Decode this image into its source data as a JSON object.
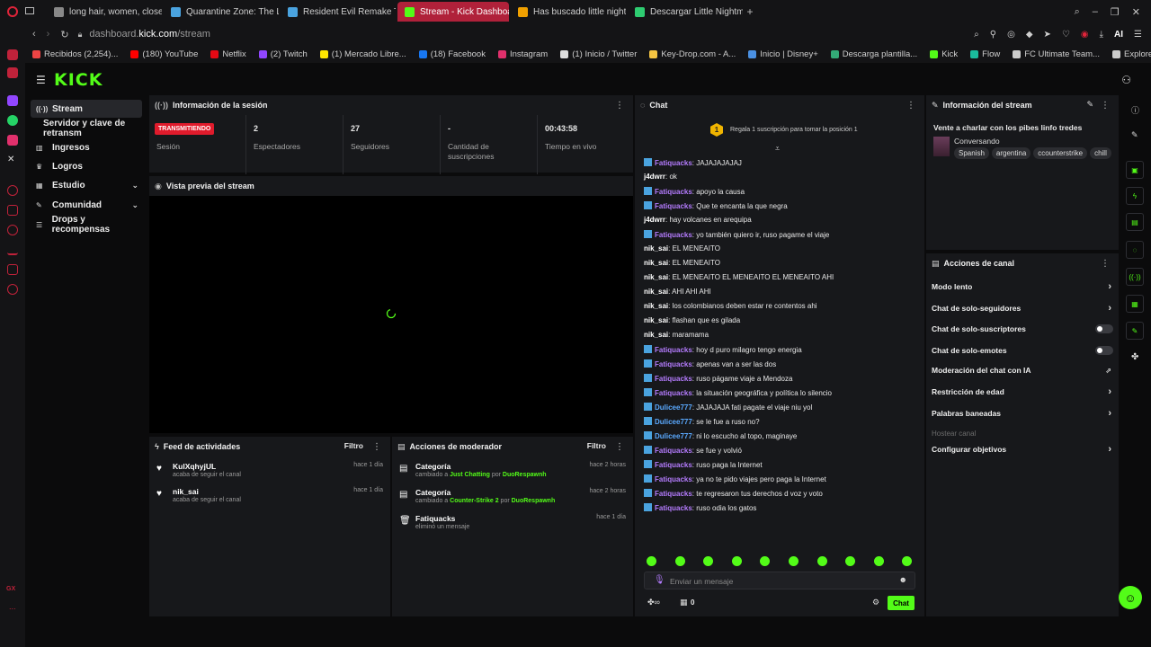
{
  "browser": {
    "tabs": [
      {
        "label": "long hair, women, closed",
        "color": "#888"
      },
      {
        "label": "Quarantine Zone: The Las",
        "color": "#4aa3df"
      },
      {
        "label": "Resident Evil Remake Trilo",
        "color": "#4aa3df"
      },
      {
        "label": "Stream - Kick Dashboard",
        "color": "#53fc18",
        "active": true
      },
      {
        "label": "Has buscado little nightma",
        "color": "#f0a000"
      },
      {
        "label": "Descargar Little Nightmare",
        "color": "#2ecc71"
      }
    ],
    "new_tab": "+",
    "url_domain": "dashboard.",
    "url_host": "kick.com",
    "url_path": "/stream",
    "ai_label": "AI",
    "bookmarks": [
      {
        "label": "Recibidos (2,254)...",
        "color": "#e44"
      },
      {
        "label": "(180) YouTube",
        "color": "#f00"
      },
      {
        "label": "Netflix",
        "color": "#e50914"
      },
      {
        "label": "(2) Twitch",
        "color": "#9146ff"
      },
      {
        "label": "(1) Mercado Libre...",
        "color": "#ffe600"
      },
      {
        "label": "(18) Facebook",
        "color": "#1877f2"
      },
      {
        "label": "Instagram",
        "color": "#e1306c"
      },
      {
        "label": "(1) Inicio / Twitter",
        "color": "#ddd"
      },
      {
        "label": "Key-Drop.com - A...",
        "color": "#f5c542"
      },
      {
        "label": "Inicio | Disney+",
        "color": "#4a90e2"
      },
      {
        "label": "Descarga plantilla...",
        "color": "#3a7"
      },
      {
        "label": "Kick",
        "color": "#53fc18"
      },
      {
        "label": "Flow",
        "color": "#1abc9c"
      },
      {
        "label": "FC Ultimate Team...",
        "color": "#ccc"
      },
      {
        "label": "Explore GPTs",
        "color": "#ccc"
      }
    ]
  },
  "opera_side": {
    "gx_label": "GX",
    "more": "..."
  },
  "kick": {
    "logo": "KICK",
    "nav": [
      {
        "label": "Stream"
      },
      {
        "label": "Servidor y clave de retransm"
      },
      {
        "label": "Ingresos"
      },
      {
        "label": "Logros"
      },
      {
        "label": "Estudio"
      },
      {
        "label": "Comunidad"
      },
      {
        "label": "Drops y recompensas"
      }
    ]
  },
  "session": {
    "title": "Información de la sesión",
    "live_badge": "TRANSMITIENDO",
    "stats": [
      {
        "value": "",
        "label": "Sesión"
      },
      {
        "value": "2",
        "label": "Espectadores"
      },
      {
        "value": "27",
        "label": "Seguidores"
      },
      {
        "value": "-",
        "label": "Cantidad de suscripciones"
      },
      {
        "value": "00:43:58",
        "label": "Tiempo en vivo"
      }
    ]
  },
  "preview": {
    "title": "Vista previa del stream"
  },
  "feed": {
    "title": "Feed de actividades",
    "filter": "Filtro",
    "items": [
      {
        "name": "KulXqhyjUL",
        "sub": "acaba de seguir el canal",
        "date": "hace 1 día"
      },
      {
        "name": "nik_sai",
        "sub": "acaba de seguir el canal",
        "date": "hace 1 día"
      }
    ]
  },
  "modactions": {
    "title": "Acciones de moderador",
    "filter": "Filtro",
    "items": [
      {
        "title": "Categoría",
        "pre": "cambiado a ",
        "cat": "Just Chatting",
        "por": " por ",
        "user": "DuoRespawnh",
        "date": "hace 2 horas"
      },
      {
        "title": "Categoría",
        "pre": "cambiado a ",
        "cat": "Counter-Strike 2",
        "por": " por ",
        "user": "DuoRespawnh",
        "date": "hace 2 horas"
      },
      {
        "title": "Fatiquacks",
        "pre": "eliminó un mensaje",
        "cat": "",
        "por": "",
        "user": "",
        "date": "hace 1 día"
      }
    ]
  },
  "chat": {
    "title": "Chat",
    "gift_rank": "1",
    "gift_text": "Regala 1 suscripción para tomar la posición 1",
    "messages": [
      {
        "user": "Fatiquacks",
        "kind": "f",
        "text": "JAJAJAJAJAJ"
      },
      {
        "user": "j4dwrr",
        "kind": "w",
        "text": "ok"
      },
      {
        "user": "Fatiquacks",
        "kind": "f",
        "text": "apoyo la causa"
      },
      {
        "user": "Fatiquacks",
        "kind": "f",
        "text": "Que te encanta la que negra"
      },
      {
        "user": "j4dwrr",
        "kind": "w",
        "text": "hay volcanes en arequipa"
      },
      {
        "user": "Fatiquacks",
        "kind": "f",
        "text": "yo también quiero ir, ruso pagame el viaje"
      },
      {
        "user": "nik_sai",
        "kind": "w",
        "text": "EL MENEAITO"
      },
      {
        "user": "nik_sai",
        "kind": "w",
        "text": "EL MENEAITO"
      },
      {
        "user": "nik_sai",
        "kind": "w",
        "text": "EL MENEAITO EL MENEAITO EL MENEAITO AHI"
      },
      {
        "user": "nik_sai",
        "kind": "w",
        "text": "AHI AHI AHI"
      },
      {
        "user": "nik_sai",
        "kind": "w",
        "text": "los colombianos deben estar re contentos ahi"
      },
      {
        "user": "nik_sai",
        "kind": "w",
        "text": "flashan que es gilada"
      },
      {
        "user": "nik_sai",
        "kind": "w",
        "text": "maramama"
      },
      {
        "user": "Fatiquacks",
        "kind": "f",
        "text": "hoy d puro milagro tengo energia"
      },
      {
        "user": "Fatiquacks",
        "kind": "f",
        "text": "apenas van a ser las dos"
      },
      {
        "user": "Fatiquacks",
        "kind": "f",
        "text": "ruso págame viaje a Mendoza"
      },
      {
        "user": "Fatiquacks",
        "kind": "f",
        "text": "la situación geográfica y política lo silencio"
      },
      {
        "user": "Dulicee777",
        "kind": "b",
        "text": "JAJAJAJA fati pagate el viaje niu yol"
      },
      {
        "user": "Dulicee777",
        "kind": "b",
        "text": "se le fue a ruso no?"
      },
      {
        "user": "Dulicee777",
        "kind": "b",
        "text": "ni lo escucho al topo, maginaye"
      },
      {
        "user": "Fatiquacks",
        "kind": "f",
        "text": "se fue y volvió"
      },
      {
        "user": "Fatiquacks",
        "kind": "f",
        "text": "ruso paga la Internet"
      },
      {
        "user": "Fatiquacks",
        "kind": "f",
        "text": "ya no te pido viajes pero paga la Internet"
      },
      {
        "user": "Fatiquacks",
        "kind": "f",
        "text": "te regresaron tus derechos d voz y voto"
      },
      {
        "user": "Fatiquacks",
        "kind": "f",
        "text": "ruso odia los gatos"
      }
    ],
    "input_placeholder": "Enviar un mensaje",
    "points": "0",
    "send": "Chat"
  },
  "streaminfo": {
    "title": "Información del stream",
    "stream_title": "Vente a charlar con los pibes linfo tredes",
    "category": "Conversando",
    "tags": [
      "Spanish",
      "argentina",
      "ccounterstrike",
      "chill"
    ]
  },
  "channel_actions": {
    "title": "Acciones de canal",
    "rows": [
      {
        "label": "Modo lento",
        "control": "chevron"
      },
      {
        "label": "Chat de solo-seguidores",
        "control": "chevron"
      },
      {
        "label": "Chat de solo-suscriptores",
        "control": "toggle"
      },
      {
        "label": "Chat de solo-emotes",
        "control": "toggle"
      },
      {
        "label": "Moderación del chat con IA",
        "control": "external"
      },
      {
        "label": "Restricción de edad",
        "control": "chevron"
      },
      {
        "label": "Palabras baneadas",
        "control": "chevron"
      },
      {
        "label": "Hostear canal",
        "control": "none",
        "disabled": true
      },
      {
        "label": "Configurar objetivos",
        "control": "chevron"
      }
    ]
  }
}
